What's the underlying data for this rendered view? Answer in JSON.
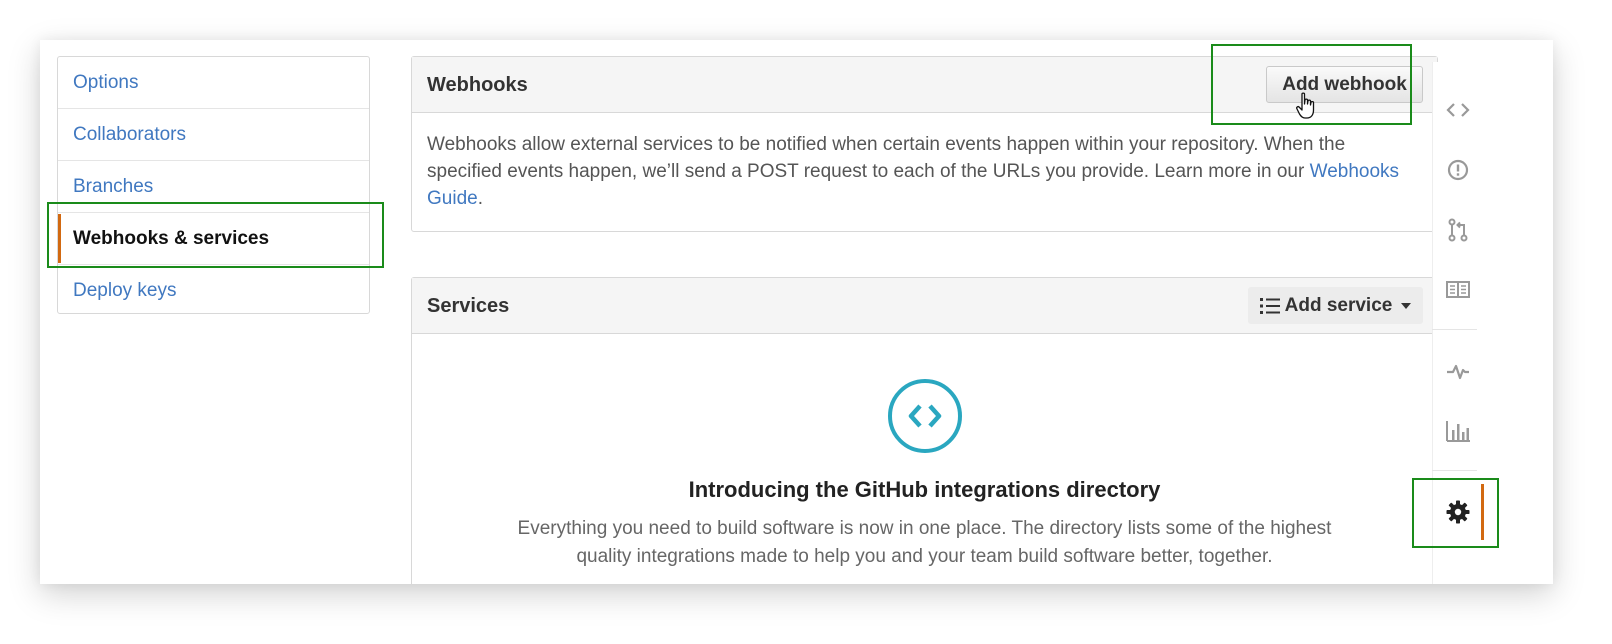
{
  "menu": {
    "items": [
      {
        "label": "Options",
        "selected": false
      },
      {
        "label": "Collaborators",
        "selected": false
      },
      {
        "label": "Branches",
        "selected": false
      },
      {
        "label": "Webhooks & services",
        "selected": true
      },
      {
        "label": "Deploy keys",
        "selected": false
      }
    ]
  },
  "webhooks": {
    "title": "Webhooks",
    "add_button": "Add webhook",
    "description": "Webhooks allow external services to be notified when certain events happen within your repository. When the specified events happen, we’ll send a POST request to each of the URLs you provide. Learn more in our ",
    "guide_link": "Webhooks Guide",
    "description_end": "."
  },
  "services": {
    "title": "Services",
    "add_button": "Add service",
    "intro_title": "Introducing the GitHub integrations directory",
    "intro_text_1": "Everything you need to build software is now in one place. The directory lists some of the highest",
    "intro_text_2": "quality integrations made to help you and your team build software better, together."
  },
  "rail": {
    "icons": [
      "code-icon",
      "issue-icon",
      "pull-request-icon",
      "wiki-icon",
      "pulse-icon",
      "graphs-icon",
      "gear-icon"
    ],
    "active": "gear-icon"
  },
  "colors": {
    "link": "#4078c0",
    "active_accent": "#d26911",
    "highlight": "#1a8b1a",
    "integration_icon": "#2aa7c0"
  }
}
